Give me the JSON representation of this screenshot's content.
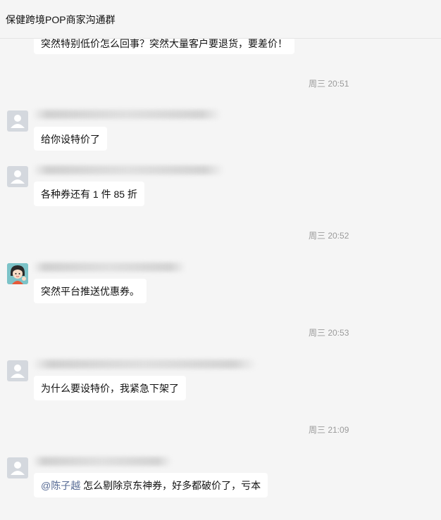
{
  "window": {
    "title": "保健跨境POP商家沟通群"
  },
  "messages": [
    {
      "type": "text",
      "text": "突然特别低价怎么回事？突然大量客户要退货，要差价！"
    },
    {
      "type": "time",
      "text": "周三 20:51"
    },
    {
      "type": "text",
      "text": "给你设特价了"
    },
    {
      "type": "text",
      "text": "各种券还有 1 件 85 折"
    },
    {
      "type": "time",
      "text": "周三 20:52"
    },
    {
      "type": "text",
      "text": "突然平台推送优惠券。"
    },
    {
      "type": "time",
      "text": "周三 20:53"
    },
    {
      "type": "text",
      "text": "为什么要设特价，我紧急下架了"
    },
    {
      "type": "time",
      "text": "周三 21:09"
    },
    {
      "type": "text",
      "mention": "@陈子越",
      "text": "  怎么剔除京东神券，好多都破价了，亏本"
    }
  ],
  "icons": {
    "default_avatar": "person-silhouette-icon",
    "cartoon_avatar": "cartoon-girl-avatar-icon"
  },
  "colors": {
    "background": "#f5f5f5",
    "bubble": "#ffffff",
    "timestamp": "#9a9a9a",
    "mention": "#576b95",
    "default_avatar": "#d4d8de"
  }
}
